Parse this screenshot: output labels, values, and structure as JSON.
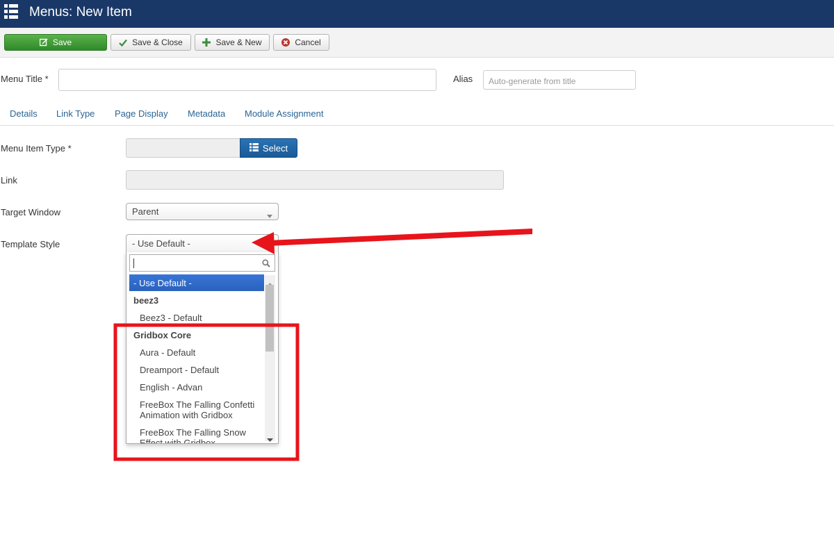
{
  "header": {
    "title": "Menus: New Item",
    "icon": "list-icon"
  },
  "toolbar": {
    "save": "Save",
    "save_close": "Save & Close",
    "save_new": "Save & New",
    "cancel": "Cancel"
  },
  "form": {
    "menu_title_label": "Menu Title *",
    "menu_title_value": "",
    "alias_label": "Alias",
    "alias_placeholder": "Auto-generate from title"
  },
  "tabs": [
    "Details",
    "Link Type",
    "Page Display",
    "Metadata",
    "Module Assignment"
  ],
  "details": {
    "menu_item_type_label": "Menu Item Type *",
    "menu_item_type_value": "",
    "select_button": "Select",
    "link_label": "Link",
    "link_value": "",
    "target_window_label": "Target Window",
    "target_window_value": "Parent",
    "template_style_label": "Template Style",
    "template_style_value": "- Use Default -"
  },
  "dropdown": {
    "search_value": "",
    "options": [
      {
        "label": "- Use Default -",
        "kind": "option",
        "highlighted": true
      },
      {
        "label": "beez3",
        "kind": "group"
      },
      {
        "label": "Beez3 - Default",
        "kind": "child"
      },
      {
        "label": "Gridbox Core",
        "kind": "group"
      },
      {
        "label": "Aura - Default",
        "kind": "child"
      },
      {
        "label": "Dreamport - Default",
        "kind": "child"
      },
      {
        "label": "English - Advan",
        "kind": "child"
      },
      {
        "label": "FreeBox The Falling Confetti Animation with Gridbox",
        "kind": "child"
      },
      {
        "label": "FreeBox The Falling Snow Effect with Gridbox",
        "kind": "child"
      }
    ]
  },
  "annotations": {
    "arrow_color": "#e8141b",
    "box_color": "#e8141b"
  },
  "colors": {
    "header_bg": "#1a3867",
    "save_green": "#3d9b36",
    "select_blue": "#1f64a6",
    "highlight": "#3875d7"
  }
}
